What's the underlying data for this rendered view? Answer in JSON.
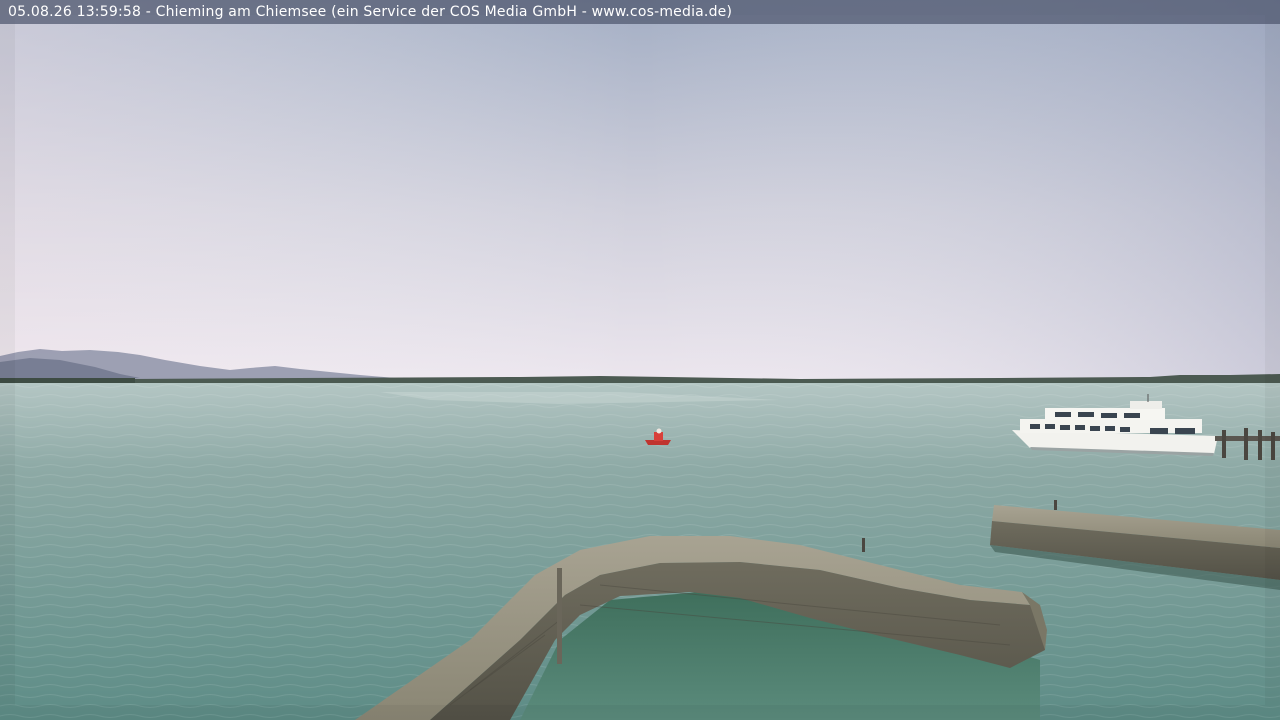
{
  "overlay": {
    "caption": "05.08.26 13:59:58 - Chieming am Chiemsee (ein Service der COS Media GmbH - www.cos-media.de)"
  },
  "scene": {
    "description_elements": [
      "sky",
      "mountains",
      "lake",
      "buoy-boat",
      "passenger-ship",
      "jetty",
      "breakwater-left",
      "breakwater-right"
    ],
    "colors": {
      "sky_top": "#a3aec4",
      "sky_horizon": "#ece6ee",
      "water_far": "#9fb4b2",
      "water_near": "#5f8e88",
      "stone": "#8d8a78",
      "ship_hull": "#f2f2ee",
      "boat_red": "#d8403a"
    }
  }
}
